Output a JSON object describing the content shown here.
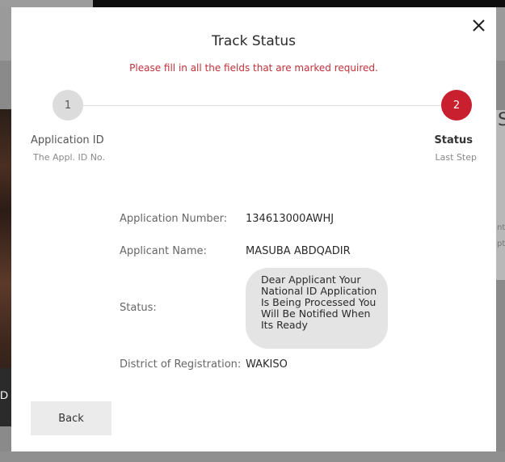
{
  "background": {
    "photo_caption": "D",
    "right_card_heading": "S",
    "right_card_line1": "nte",
    "right_card_line2": "ptio"
  },
  "modal": {
    "title": "Track Status",
    "error_message": "Please fill in all the fields that are marked required.",
    "close_icon": "close-icon",
    "steps": [
      {
        "number": "1",
        "label": "Application ID",
        "sublabel": "The Appl. ID No.",
        "active": false
      },
      {
        "number": "2",
        "label": "Status",
        "sublabel": "Last Step",
        "active": true
      }
    ],
    "fields": {
      "application_number": {
        "label": "Application Number:",
        "value": "134613000AWHJ"
      },
      "applicant_name": {
        "label": "Applicant Name:",
        "value": "MASUBA ABDQADIR"
      },
      "status": {
        "label": "Status:",
        "value": "Dear Applicant Your National ID Application Is Being Processed You Will Be Notified When Its Ready"
      },
      "district": {
        "label": "District of Registration:",
        "value": "WAKISO"
      }
    },
    "back_label": "Back"
  },
  "colors": {
    "accent": "#c8202f",
    "error_text": "#c0303a",
    "step_inactive": "#dcdcdc",
    "bubble": "#e4e4e4"
  }
}
